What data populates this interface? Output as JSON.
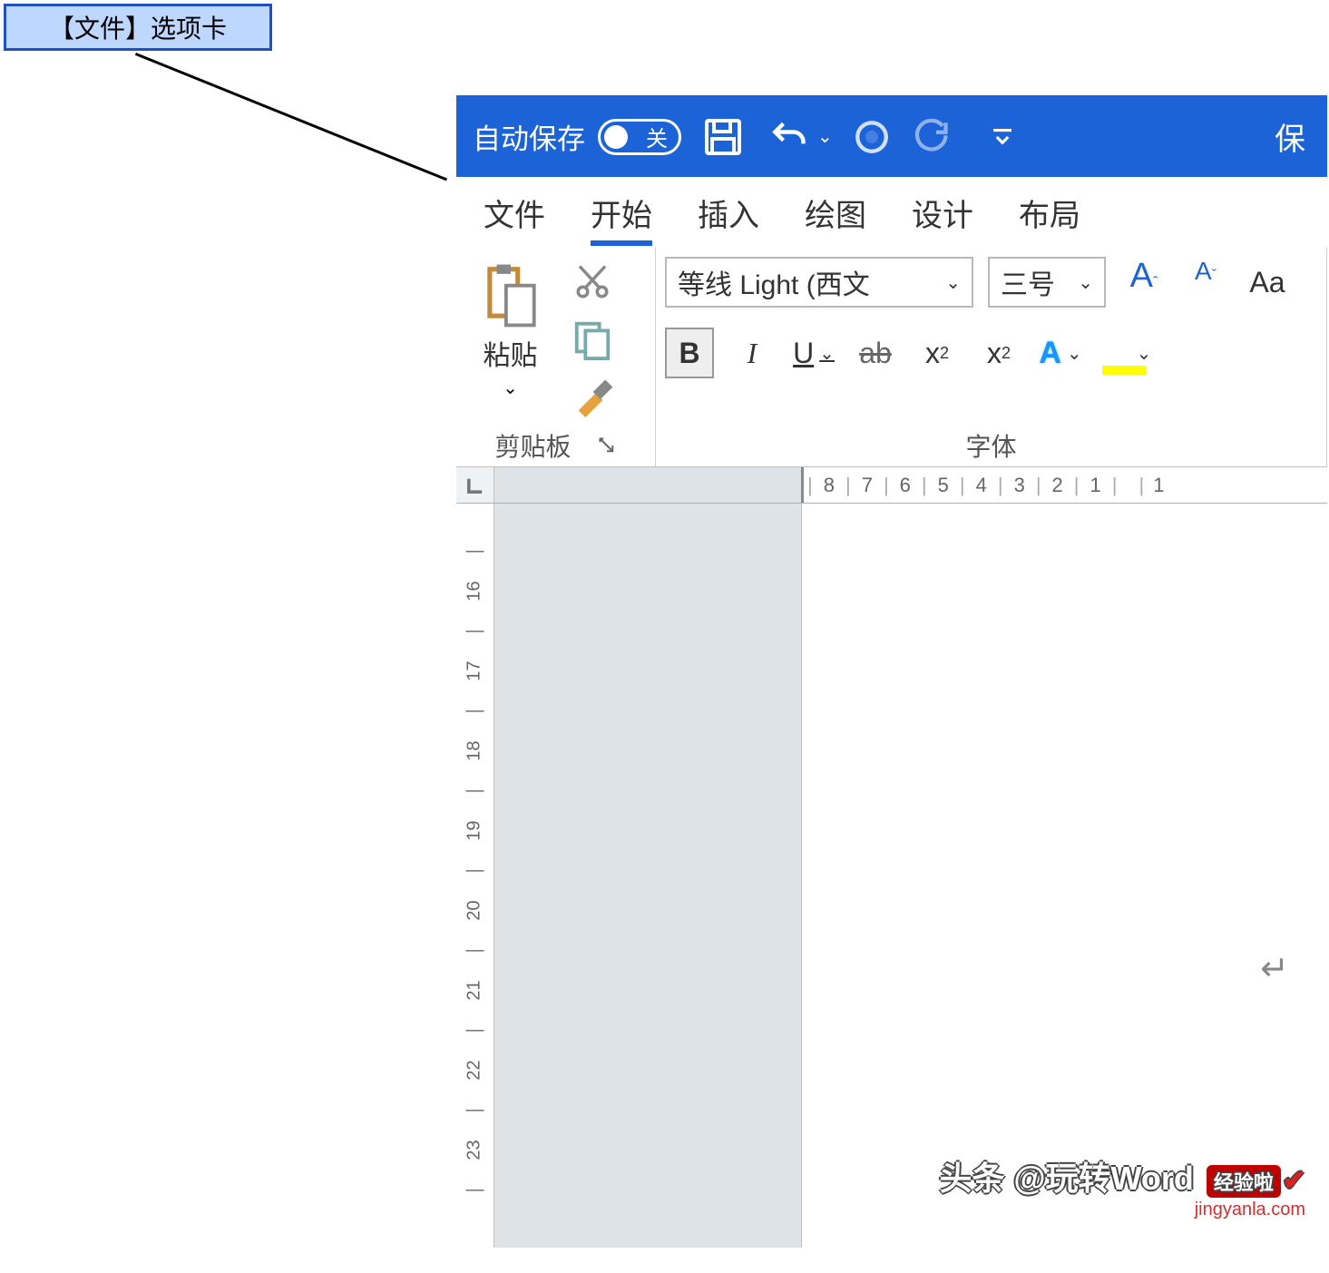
{
  "callout": {
    "label": "【文件】选项卡"
  },
  "titlebar": {
    "autosave_label": "自动保存",
    "autosave_state": "关",
    "title_right": "保"
  },
  "tabs": [
    {
      "id": "file",
      "label": "文件",
      "active": false
    },
    {
      "id": "home",
      "label": "开始",
      "active": true
    },
    {
      "id": "insert",
      "label": "插入",
      "active": false
    },
    {
      "id": "draw",
      "label": "绘图",
      "active": false
    },
    {
      "id": "design",
      "label": "设计",
      "active": false
    },
    {
      "id": "layout",
      "label": "布局",
      "active": false
    }
  ],
  "clipboard": {
    "paste": "粘贴",
    "group_label": "剪贴板"
  },
  "font": {
    "font_name": "等线 Light (西文",
    "font_size": "三号",
    "grow_a": "A",
    "shrink_a": "A",
    "case_a": "Aa",
    "bold": "B",
    "italic": "I",
    "underline": "U",
    "strike": "ab",
    "subscript_x": "x",
    "subscript_2": "2",
    "superscript_x": "x",
    "superscript_2": "2",
    "text_effect": "A",
    "group_label": "字体"
  },
  "ruler": {
    "h_marks": [
      "8",
      "7",
      "6",
      "5",
      "4",
      "3",
      "2",
      "1"
    ],
    "h_tail": "1",
    "v_marks": [
      "16",
      "17",
      "18",
      "19",
      "20",
      "21",
      "22",
      "23"
    ]
  },
  "watermark": {
    "line1": "头条 @玩转Word",
    "badge": "经验啦",
    "url": "jingyanla.com"
  }
}
